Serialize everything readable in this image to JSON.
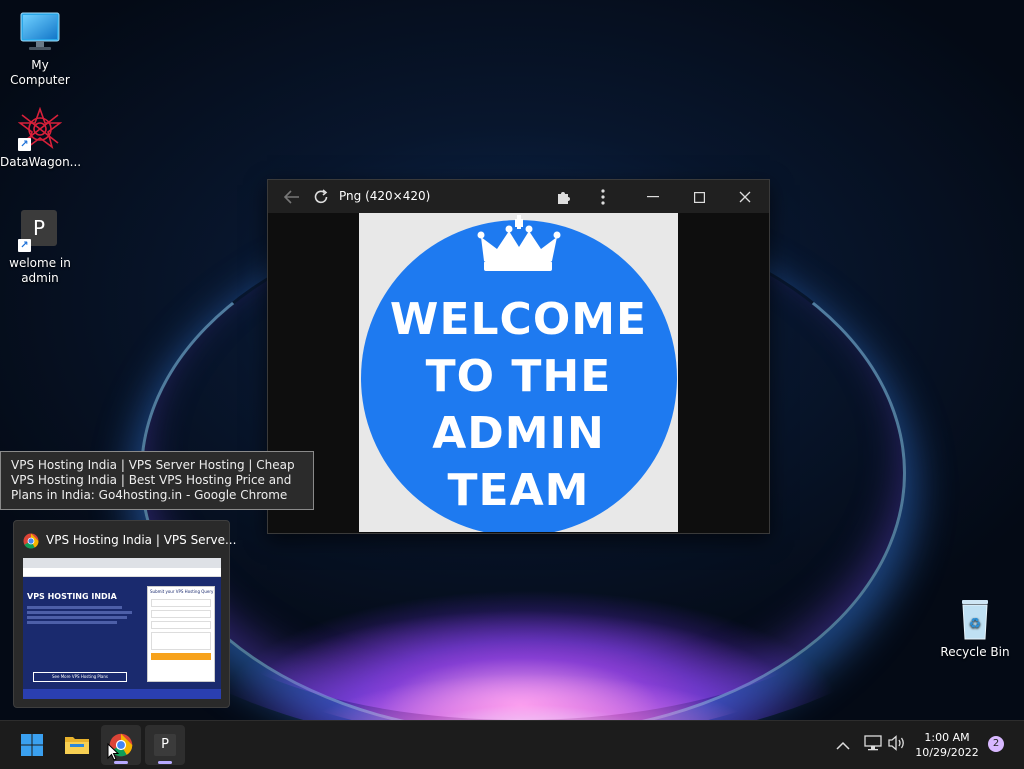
{
  "desktop": {
    "icons": [
      {
        "label": "My Computer"
      },
      {
        "label": "DataWagon..."
      },
      {
        "label": "welome in admin",
        "glyph": "P"
      },
      {
        "label": "Recycle Bin"
      }
    ]
  },
  "viewer": {
    "title": "Png (420×420)",
    "image_text": [
      "WELCOME",
      "TO THE",
      "ADMIN",
      "TEAM"
    ],
    "circle_color": "#1e7af0"
  },
  "tooltip": {
    "text": "VPS Hosting India | VPS Server Hosting | Cheap VPS Hosting India | Best VPS Hosting Price and Plans in India: Go4hosting.in - Google Chrome"
  },
  "preview": {
    "title": "VPS Hosting India | VPS Serve...",
    "thumb_heading": "VPS HOSTING INDIA",
    "thumb_cta": "See More VPS Hosting Plans",
    "thumb_form": "Submit your VPS Hosting Query"
  },
  "taskbar": {
    "app_glyph": "P",
    "time": "1:00 AM",
    "date": "10/29/2022",
    "notifications": "2"
  }
}
